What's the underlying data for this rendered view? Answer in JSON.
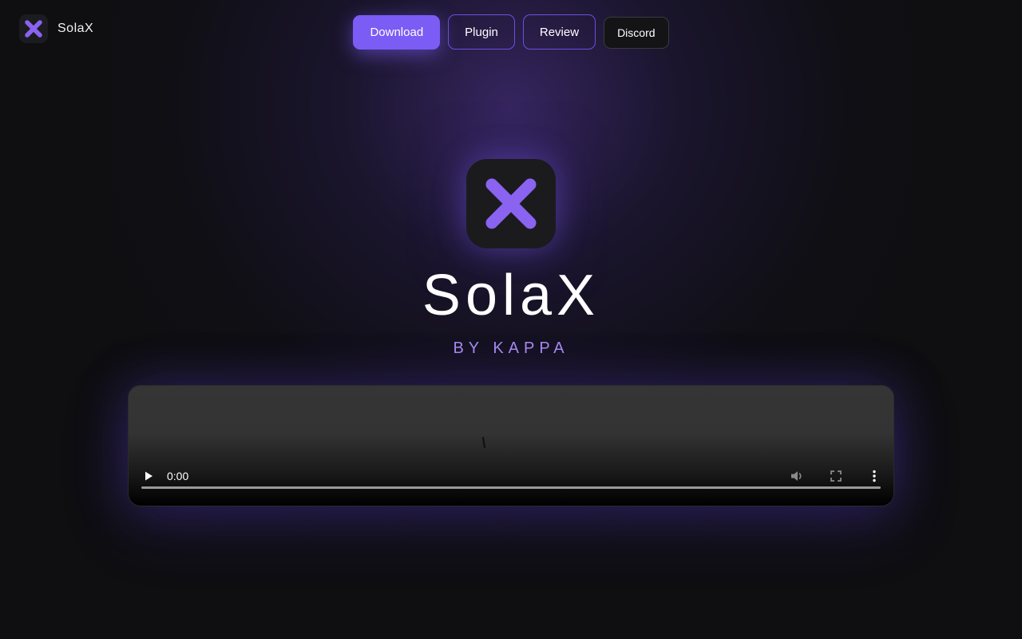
{
  "brand": {
    "name": "SolaX",
    "logo_icon": "x-logo-icon"
  },
  "nav": {
    "download_label": "Download",
    "plugin_label": "Plugin",
    "review_label": "Review",
    "discord_label": "Discord"
  },
  "hero": {
    "logo_icon": "x-logo-icon",
    "title": "SolaX",
    "subtitle": "BY KAPPA"
  },
  "video": {
    "current_time": "0:00",
    "progress": 0,
    "icons": [
      "play-icon",
      "volume-icon",
      "fullscreen-icon",
      "more-icon",
      "loading-spinner-icon"
    ]
  },
  "colors": {
    "accent": "#7b5cf5",
    "subtitle": "#a98cf2",
    "background": "#0f0f12"
  }
}
